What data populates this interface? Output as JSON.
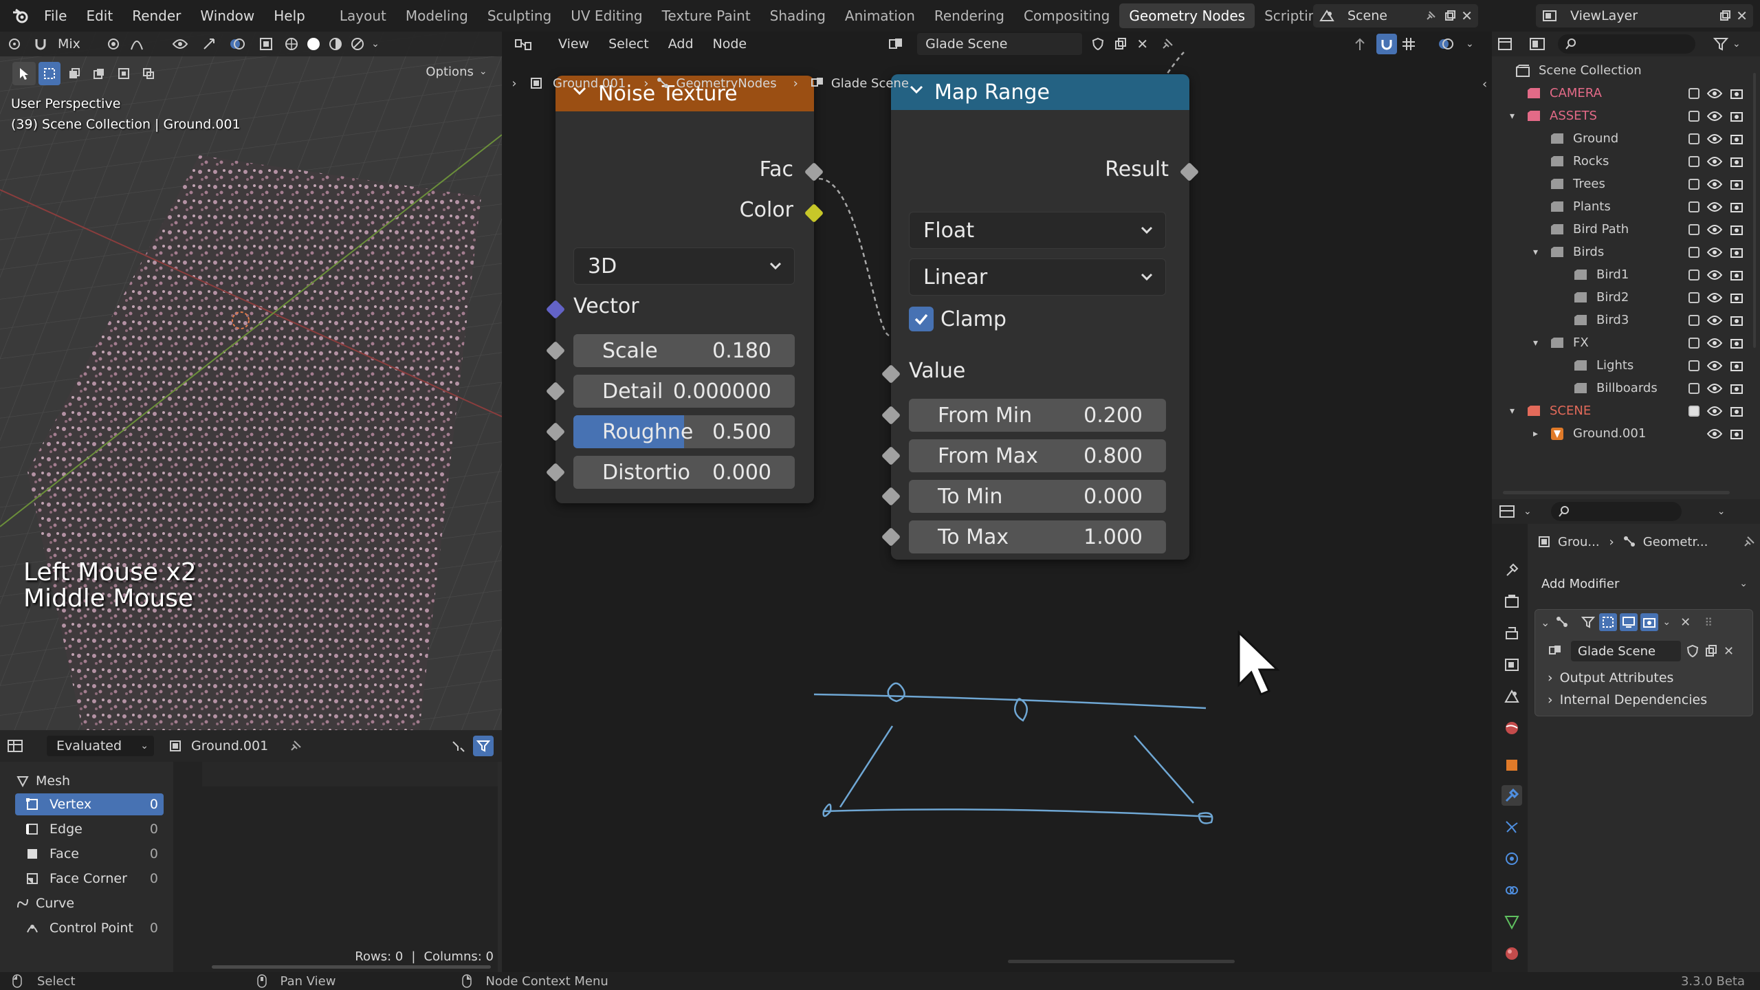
{
  "topbar": {
    "menus": [
      "File",
      "Edit",
      "Render",
      "Window",
      "Help"
    ],
    "workspaces": [
      "Layout",
      "Modeling",
      "Sculpting",
      "UV Editing",
      "Texture Paint",
      "Shading",
      "Animation",
      "Rendering",
      "Compositing",
      "Geometry Nodes",
      "Scripting"
    ],
    "active_workspace": "Geometry Nodes",
    "scene": "Scene",
    "view_layer": "ViewLayer"
  },
  "viewport": {
    "blend_mode": "Mix",
    "options_label": "Options",
    "view_name": "User Perspective",
    "context": "(39) Scene Collection | Ground.001",
    "key_hint_1": "Left Mouse x2",
    "key_hint_2": "Middle Mouse"
  },
  "spreadsheet": {
    "mode": "Evaluated",
    "object": "Ground.001",
    "groups": [
      {
        "label": "Mesh"
      },
      {
        "label": "Curve"
      }
    ],
    "rows": [
      {
        "label": "Vertex",
        "count": "0"
      },
      {
        "label": "Edge",
        "count": "0"
      },
      {
        "label": "Face",
        "count": "0"
      },
      {
        "label": "Face Corner",
        "count": "0"
      },
      {
        "label": "Control Point",
        "count": "0"
      }
    ],
    "rows_info": "Rows: 0",
    "cols_info": "Columns: 0"
  },
  "node_editor": {
    "menus": [
      "View",
      "Select",
      "Add",
      "Node"
    ],
    "node_tree": "Glade Scene",
    "breadcrumb": [
      "Ground.001",
      "GeometryNodes",
      "Glade Scene"
    ],
    "noise": {
      "title": "Noise Texture",
      "out_fac": "Fac",
      "out_color": "Color",
      "dimensions": "3D",
      "in_vector": "Vector",
      "fields": [
        {
          "label": "Scale",
          "value": "0.180"
        },
        {
          "label": "Detail",
          "value": "0.000000"
        },
        {
          "label": "Roughne",
          "value": "0.500",
          "fill": 0.5
        },
        {
          "label": "Distortio",
          "value": "0.000"
        }
      ]
    },
    "map_range": {
      "title": "Map Range",
      "out_result": "Result",
      "data_type": "Float",
      "interpolation": "Linear",
      "clamp_label": "Clamp",
      "clamp_checked": true,
      "in_value": "Value",
      "fields": [
        {
          "label": "From Min",
          "value": "0.200"
        },
        {
          "label": "From Max",
          "value": "0.800"
        },
        {
          "label": "To Min",
          "value": "0.000"
        },
        {
          "label": "To Max",
          "value": "1.000"
        }
      ]
    }
  },
  "outliner": {
    "title": "Scene Collection",
    "items": [
      {
        "name": "CAMERA",
        "color": "#e36a87"
      },
      {
        "name": "ASSETS",
        "color": "#e36a87"
      },
      {
        "name": "Ground"
      },
      {
        "name": "Rocks"
      },
      {
        "name": "Trees"
      },
      {
        "name": "Plants"
      },
      {
        "name": "Bird Path"
      },
      {
        "name": "Birds"
      },
      {
        "name": "Bird1"
      },
      {
        "name": "Bird2"
      },
      {
        "name": "Bird3"
      },
      {
        "name": "FX"
      },
      {
        "name": "Lights"
      },
      {
        "name": "Billboards"
      },
      {
        "name": "SCENE",
        "color": "#e36a5a"
      },
      {
        "name": "Ground.001"
      }
    ]
  },
  "properties": {
    "breadcrumb_1": "Grou...",
    "breadcrumb_2": "Geometr...",
    "add_modifier": "Add Modifier",
    "modifier_tree": "Glade Scene",
    "panels": [
      "Output Attributes",
      "Internal Dependencies"
    ]
  },
  "statusbar": {
    "select": "Select",
    "pan": "Pan View",
    "context": "Node Context Menu",
    "version": "3.3.0 Beta"
  },
  "colors": {
    "noise_header": "#9b4f13",
    "map_range_header": "#246283",
    "accent": "#4772b3",
    "socket_gray": "#a1a1a1",
    "socket_yellow": "#c7c729",
    "socket_purple": "#6363c7"
  }
}
